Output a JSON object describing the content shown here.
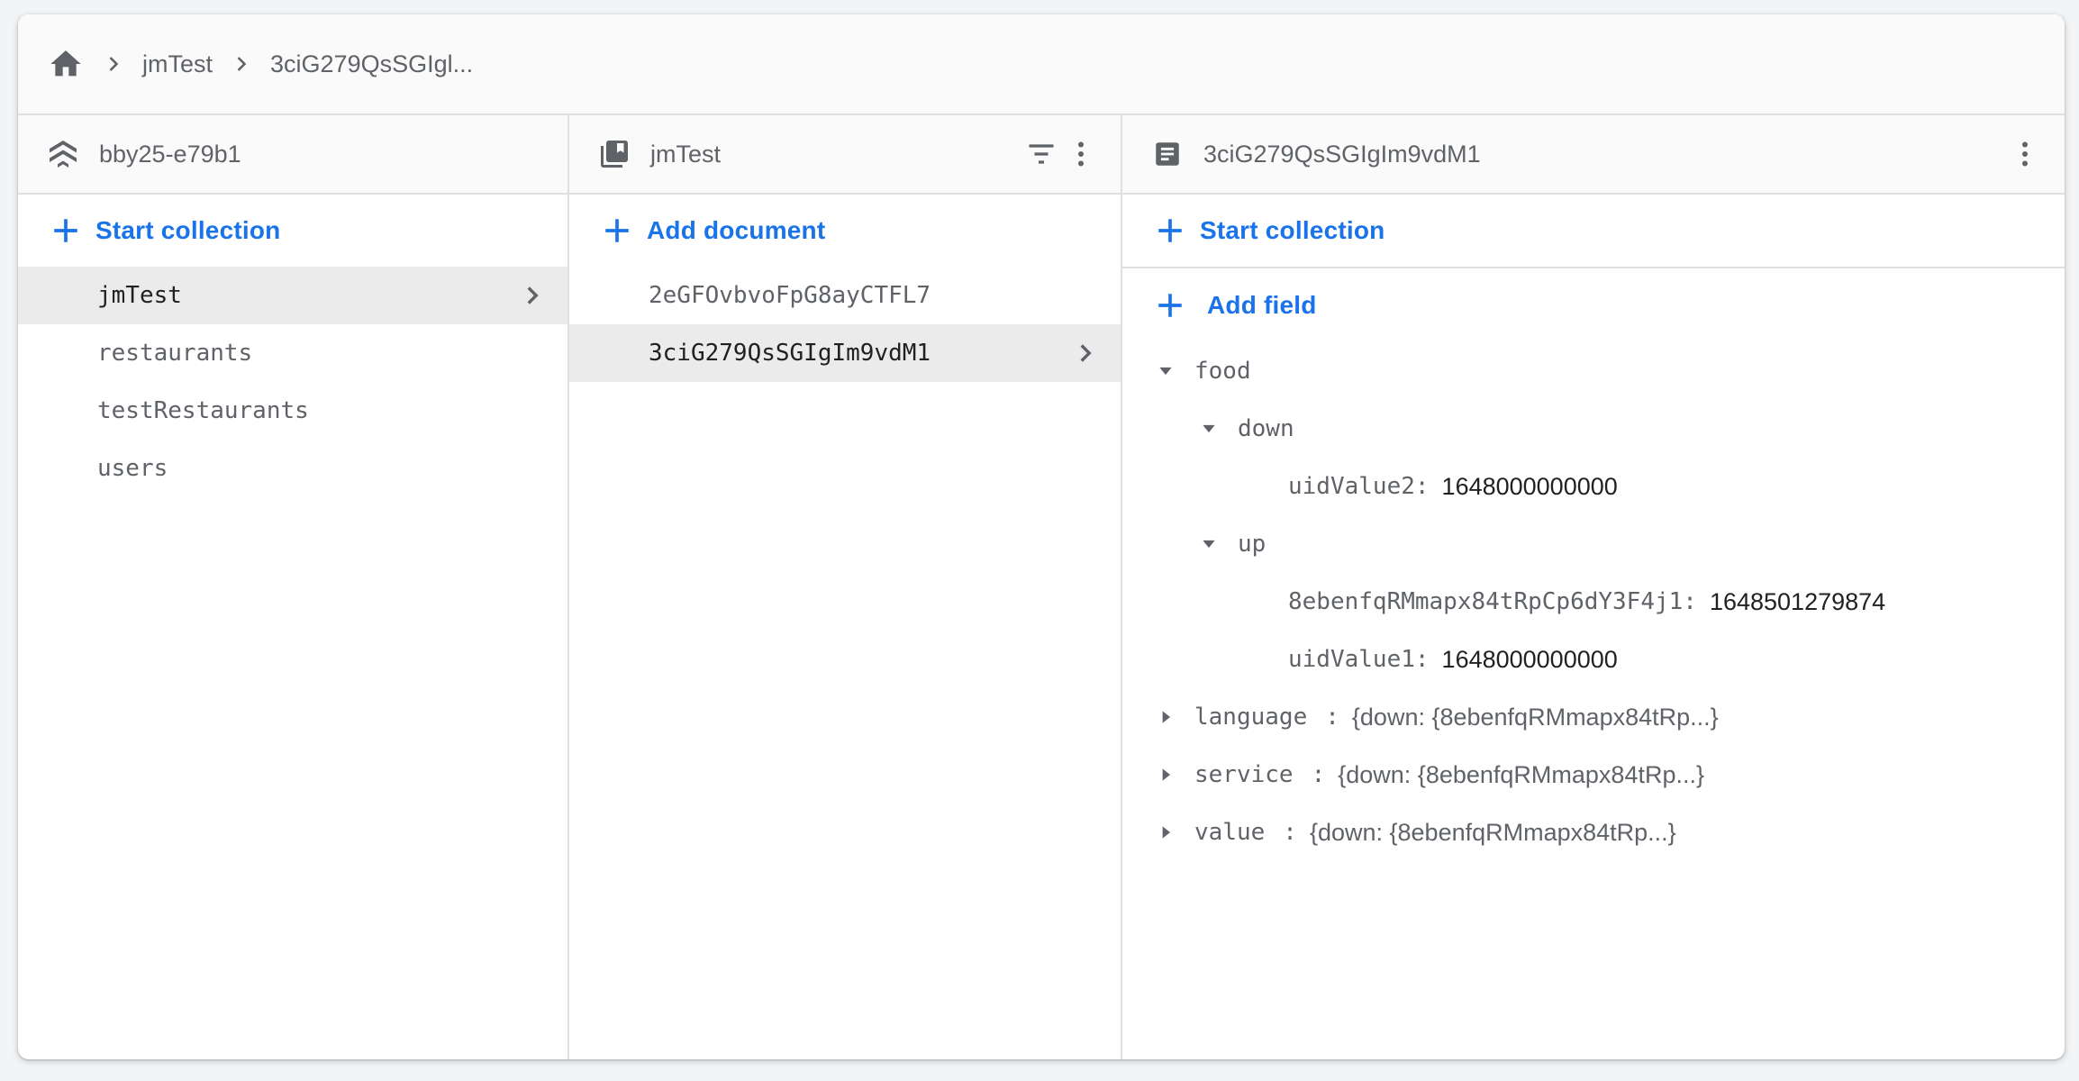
{
  "breadcrumb": {
    "home_icon": "home-icon",
    "items": [
      "jmTest",
      "3ciG279QsSGIgl..."
    ]
  },
  "colors": {
    "accent": "#1a73e8",
    "selected_row": "#ebebeb",
    "header_bg": "#fafafa",
    "icon_gray": "#5f6368"
  },
  "project_column": {
    "icon": "firestore-project-icon",
    "title": "bby25-e79b1",
    "action_label": "Start collection",
    "items": [
      {
        "label": "jmTest",
        "selected": true
      },
      {
        "label": "restaurants",
        "selected": false
      },
      {
        "label": "testRestaurants",
        "selected": false
      },
      {
        "label": "users",
        "selected": false
      }
    ]
  },
  "collection_column": {
    "icon": "collection-icon",
    "title": "jmTest",
    "filter_icon": "filter-icon",
    "menu_icon": "more-vert-icon",
    "action_label": "Add document",
    "items": [
      {
        "label": "2eGFOvbvoFpG8ayCTFL7",
        "selected": false
      },
      {
        "label": "3ciG279QsSGIgIm9vdM1",
        "selected": true
      }
    ]
  },
  "document_column": {
    "icon": "document-icon",
    "title": "3ciG279QsSGIgIm9vdM1",
    "menu_icon": "more-vert-icon",
    "start_collection_label": "Start collection",
    "add_field_label": "Add field",
    "fields": [
      {
        "key": "food",
        "expanded": true,
        "level": 0
      },
      {
        "key": "down",
        "expanded": true,
        "level": 1
      },
      {
        "key": "uidValue2",
        "value": "1648000000000",
        "level": 2
      },
      {
        "key": "up",
        "expanded": true,
        "level": 1
      },
      {
        "key": "8ebenfqRMmapx84tRpCp6dY3F4j1",
        "value": "1648501279874",
        "level": 2
      },
      {
        "key": "uidValue1",
        "value": "1648000000000",
        "level": 2
      },
      {
        "key": "language",
        "summary": "{down: {8ebenfqRMmapx84tRp...}",
        "expanded": false,
        "level": 0
      },
      {
        "key": "service",
        "summary": "{down: {8ebenfqRMmapx84tRp...}",
        "expanded": false,
        "level": 0
      },
      {
        "key": "value",
        "summary": "{down: {8ebenfqRMmapx84tRp...}",
        "expanded": false,
        "level": 0
      }
    ]
  }
}
